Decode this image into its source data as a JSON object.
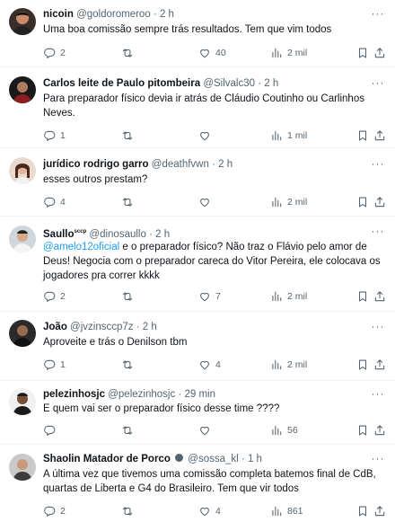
{
  "tweets": [
    {
      "name": "nicoin",
      "handle": "@goldoromeroo",
      "sep": "·",
      "time": "2 h",
      "text": "Uma boa comissão sempre trás resultados. Tem que vim todos",
      "replies": "2",
      "retweets": "",
      "likes": "40",
      "views": "2 mil"
    },
    {
      "name": "Carlos leite de Paulo pitombeira",
      "handle": "@Silvalc30",
      "sep": "·",
      "time": "2 h",
      "text": "Para preparador físico devia ir atrás de Cláudio Coutinho ou Carlinhos Neves.",
      "replies": "1",
      "retweets": "",
      "likes": "",
      "views": "1 mil"
    },
    {
      "name": "jurídico rodrigo garro",
      "handle": "@deathfvwn",
      "sep": "·",
      "time": "2 h",
      "text": "esses outros prestam?",
      "replies": "4",
      "retweets": "",
      "likes": "",
      "views": "2 mil"
    },
    {
      "name": "Saullo",
      "name_suffix": "sccp",
      "handle": "@dinosaullo",
      "sep": "·",
      "time": "2 h",
      "mention": "@amelo12oficial",
      "text": " e o preparador físico? Não traz o Flávio pelo amor de Deus! Negocia com o preparador careca do Vitor Pereira, ele colocava os jogadores pra correr kkkk",
      "replies": "2",
      "retweets": "",
      "likes": "7",
      "views": "2 mil"
    },
    {
      "name": "João",
      "handle": "@jvzinsccp7z",
      "sep": "·",
      "time": "2 h",
      "text": "Aproveite e trás o Denilson tbm",
      "replies": "1",
      "retweets": "",
      "likes": "4",
      "views": "2 mil"
    },
    {
      "name": "pelezinhosjc",
      "handle": "@pelezinhosjc",
      "sep": "·",
      "time": "29 min",
      "text": "E quem vai ser o preparador físico desse time ????",
      "replies": "",
      "retweets": "",
      "likes": "",
      "views": "56"
    },
    {
      "name": "Shaolin Matador de Porco",
      "handle": "@sossa_kl",
      "sep": "·",
      "time": "1 h",
      "text": "A última vez que tivemos uma comissão completa batemos final de CdB, quartas de Liberta e G4 do Brasileiro. Tem que vir todos",
      "replies": "2",
      "retweets": "",
      "likes": "4",
      "views": "861"
    }
  ],
  "more_glyph": "···",
  "colors": {
    "text": "#0f1419",
    "muted": "#536471",
    "link": "#1d9bf0",
    "divider": "#eff3f4"
  },
  "icons": [
    "reply-icon",
    "retweet-icon",
    "like-icon",
    "views-icon",
    "bookmark-icon",
    "share-icon",
    "more-icon"
  ]
}
